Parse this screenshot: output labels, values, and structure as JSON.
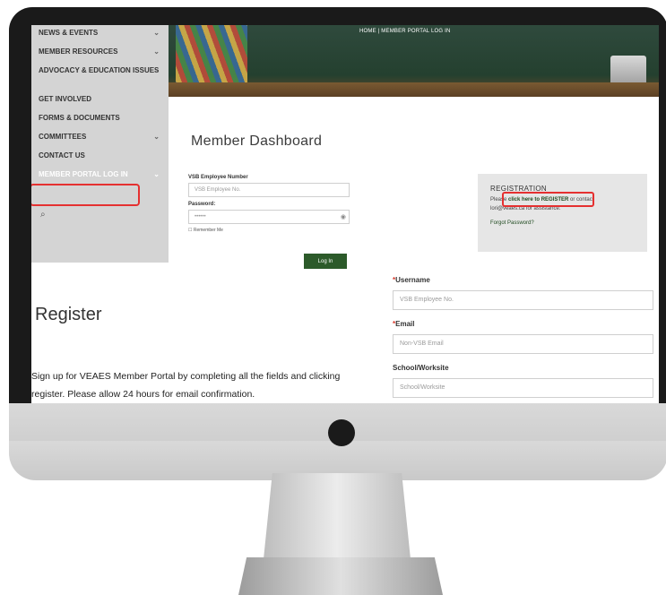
{
  "breadcrumb": "HOME | MEMBER PORTAL LOG IN",
  "nav": [
    {
      "label": "NEWS & EVENTS",
      "chev": "⌄"
    },
    {
      "label": "MEMBER RESOURCES",
      "chev": "⌄"
    },
    {
      "label": "ADVOCACY & EDUCATION ISSUES",
      "chev": "⌄"
    },
    {
      "label": "GET INVOLVED",
      "chev": ""
    },
    {
      "label": "FORMS & DOCUMENTS",
      "chev": ""
    },
    {
      "label": "COMMITTEES",
      "chev": "⌄"
    },
    {
      "label": "CONTACT US",
      "chev": ""
    },
    {
      "label": "MEMBER PORTAL LOG IN",
      "chev": "⌄"
    }
  ],
  "dashboard": {
    "title": "Member Dashboard",
    "employee_label": "VSB Employee Number",
    "employee_placeholder": "VSB Employee No.",
    "password_label": "Password:",
    "password_value": "••••••",
    "remember": "Remember Me",
    "login_button": "Log In"
  },
  "registration": {
    "title": "REGISTRATION",
    "line_prefix": "Please ",
    "link": "click here to REGISTER",
    "line_suffix": " or contact",
    "email_line": "lori@veaes.ca for assistance.",
    "forgot": "Forgot Password?"
  },
  "register": {
    "heading": "Register",
    "description": "Sign up for VEAES Member Portal by completing all the fields and clicking register. Please allow 24 hours for email confirmation.",
    "fields": [
      {
        "label": "Username",
        "required": "*",
        "placeholder": "VSB Employee No."
      },
      {
        "label": "Email",
        "required": "*",
        "placeholder": "Non-VSB Email"
      },
      {
        "label": "School/Worksite",
        "required": "",
        "placeholder": "School/Worksite"
      }
    ]
  }
}
